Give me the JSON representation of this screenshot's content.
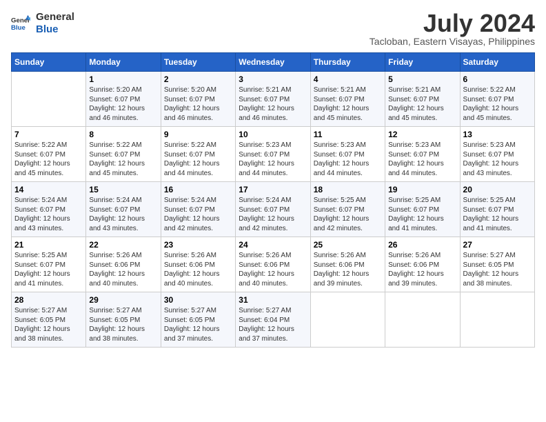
{
  "header": {
    "logo_line1": "General",
    "logo_line2": "Blue",
    "month_year": "July 2024",
    "location": "Tacloban, Eastern Visayas, Philippines"
  },
  "weekdays": [
    "Sunday",
    "Monday",
    "Tuesday",
    "Wednesday",
    "Thursday",
    "Friday",
    "Saturday"
  ],
  "weeks": [
    [
      {
        "day": "",
        "info": ""
      },
      {
        "day": "1",
        "info": "Sunrise: 5:20 AM\nSunset: 6:07 PM\nDaylight: 12 hours\nand 46 minutes."
      },
      {
        "day": "2",
        "info": "Sunrise: 5:20 AM\nSunset: 6:07 PM\nDaylight: 12 hours\nand 46 minutes."
      },
      {
        "day": "3",
        "info": "Sunrise: 5:21 AM\nSunset: 6:07 PM\nDaylight: 12 hours\nand 46 minutes."
      },
      {
        "day": "4",
        "info": "Sunrise: 5:21 AM\nSunset: 6:07 PM\nDaylight: 12 hours\nand 45 minutes."
      },
      {
        "day": "5",
        "info": "Sunrise: 5:21 AM\nSunset: 6:07 PM\nDaylight: 12 hours\nand 45 minutes."
      },
      {
        "day": "6",
        "info": "Sunrise: 5:22 AM\nSunset: 6:07 PM\nDaylight: 12 hours\nand 45 minutes."
      }
    ],
    [
      {
        "day": "7",
        "info": "Sunrise: 5:22 AM\nSunset: 6:07 PM\nDaylight: 12 hours\nand 45 minutes."
      },
      {
        "day": "8",
        "info": "Sunrise: 5:22 AM\nSunset: 6:07 PM\nDaylight: 12 hours\nand 45 minutes."
      },
      {
        "day": "9",
        "info": "Sunrise: 5:22 AM\nSunset: 6:07 PM\nDaylight: 12 hours\nand 44 minutes."
      },
      {
        "day": "10",
        "info": "Sunrise: 5:23 AM\nSunset: 6:07 PM\nDaylight: 12 hours\nand 44 minutes."
      },
      {
        "day": "11",
        "info": "Sunrise: 5:23 AM\nSunset: 6:07 PM\nDaylight: 12 hours\nand 44 minutes."
      },
      {
        "day": "12",
        "info": "Sunrise: 5:23 AM\nSunset: 6:07 PM\nDaylight: 12 hours\nand 44 minutes."
      },
      {
        "day": "13",
        "info": "Sunrise: 5:23 AM\nSunset: 6:07 PM\nDaylight: 12 hours\nand 43 minutes."
      }
    ],
    [
      {
        "day": "14",
        "info": "Sunrise: 5:24 AM\nSunset: 6:07 PM\nDaylight: 12 hours\nand 43 minutes."
      },
      {
        "day": "15",
        "info": "Sunrise: 5:24 AM\nSunset: 6:07 PM\nDaylight: 12 hours\nand 43 minutes."
      },
      {
        "day": "16",
        "info": "Sunrise: 5:24 AM\nSunset: 6:07 PM\nDaylight: 12 hours\nand 42 minutes."
      },
      {
        "day": "17",
        "info": "Sunrise: 5:24 AM\nSunset: 6:07 PM\nDaylight: 12 hours\nand 42 minutes."
      },
      {
        "day": "18",
        "info": "Sunrise: 5:25 AM\nSunset: 6:07 PM\nDaylight: 12 hours\nand 42 minutes."
      },
      {
        "day": "19",
        "info": "Sunrise: 5:25 AM\nSunset: 6:07 PM\nDaylight: 12 hours\nand 41 minutes."
      },
      {
        "day": "20",
        "info": "Sunrise: 5:25 AM\nSunset: 6:07 PM\nDaylight: 12 hours\nand 41 minutes."
      }
    ],
    [
      {
        "day": "21",
        "info": "Sunrise: 5:25 AM\nSunset: 6:07 PM\nDaylight: 12 hours\nand 41 minutes."
      },
      {
        "day": "22",
        "info": "Sunrise: 5:26 AM\nSunset: 6:06 PM\nDaylight: 12 hours\nand 40 minutes."
      },
      {
        "day": "23",
        "info": "Sunrise: 5:26 AM\nSunset: 6:06 PM\nDaylight: 12 hours\nand 40 minutes."
      },
      {
        "day": "24",
        "info": "Sunrise: 5:26 AM\nSunset: 6:06 PM\nDaylight: 12 hours\nand 40 minutes."
      },
      {
        "day": "25",
        "info": "Sunrise: 5:26 AM\nSunset: 6:06 PM\nDaylight: 12 hours\nand 39 minutes."
      },
      {
        "day": "26",
        "info": "Sunrise: 5:26 AM\nSunset: 6:06 PM\nDaylight: 12 hours\nand 39 minutes."
      },
      {
        "day": "27",
        "info": "Sunrise: 5:27 AM\nSunset: 6:05 PM\nDaylight: 12 hours\nand 38 minutes."
      }
    ],
    [
      {
        "day": "28",
        "info": "Sunrise: 5:27 AM\nSunset: 6:05 PM\nDaylight: 12 hours\nand 38 minutes."
      },
      {
        "day": "29",
        "info": "Sunrise: 5:27 AM\nSunset: 6:05 PM\nDaylight: 12 hours\nand 38 minutes."
      },
      {
        "day": "30",
        "info": "Sunrise: 5:27 AM\nSunset: 6:05 PM\nDaylight: 12 hours\nand 37 minutes."
      },
      {
        "day": "31",
        "info": "Sunrise: 5:27 AM\nSunset: 6:04 PM\nDaylight: 12 hours\nand 37 minutes."
      },
      {
        "day": "",
        "info": ""
      },
      {
        "day": "",
        "info": ""
      },
      {
        "day": "",
        "info": ""
      }
    ]
  ]
}
